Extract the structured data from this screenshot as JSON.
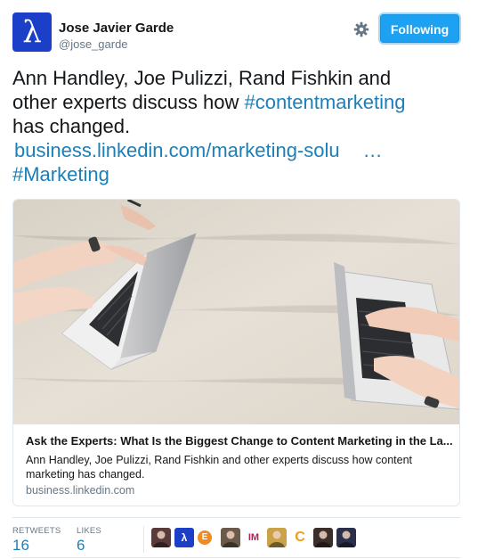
{
  "user": {
    "name": "Jose Javier Garde",
    "handle": "@jose_garde",
    "avatar_glyph": "λ",
    "avatar_color": "#1b3fc7"
  },
  "actions": {
    "settings_icon": "gear-icon",
    "follow_label": "Following",
    "accent": "#1da1f2"
  },
  "tweet": {
    "line1": "Ann Handley, Joe Pulizzi, Rand Fishkin and",
    "line2a": "other experts discuss how ",
    "line2_hashtag": "#contentmarketing",
    "line3": "has changed.",
    "link": "business.linkedin.com/marketing-solu",
    "link_ellipsis": "…",
    "hashtag2": "#Marketing"
  },
  "card": {
    "title": "Ask the Experts: What Is the Biggest Change to Content Marketing in the La...",
    "description": "Ann Handley, Joe Pulizzi, Rand Fishkin and other experts discuss how content marketing has changed.",
    "domain": "business.linkedin.com"
  },
  "stats": {
    "retweets_label": "RETWEETS",
    "retweets_value": "16",
    "likes_label": "LIKES",
    "likes_value": "6"
  },
  "likers": [
    {
      "name": "liker-avatar-1",
      "glyph": "",
      "color": "#5a3b3b"
    },
    {
      "name": "liker-avatar-2",
      "glyph": "λ",
      "color": "#1b3fc7"
    },
    {
      "name": "liker-avatar-3",
      "glyph": "E",
      "color": "#f08a24"
    },
    {
      "name": "liker-avatar-4",
      "glyph": "",
      "color": "#6b5a4a"
    },
    {
      "name": "liker-avatar-5",
      "glyph": "IM",
      "color": "#ffffff"
    },
    {
      "name": "liker-avatar-6",
      "glyph": "",
      "color": "#c9a24a"
    },
    {
      "name": "liker-avatar-7",
      "glyph": "C",
      "color": "#ffffff"
    },
    {
      "name": "liker-avatar-8",
      "glyph": "",
      "color": "#3a2f2a"
    },
    {
      "name": "liker-avatar-9",
      "glyph": "",
      "color": "#2b2f4a"
    }
  ]
}
